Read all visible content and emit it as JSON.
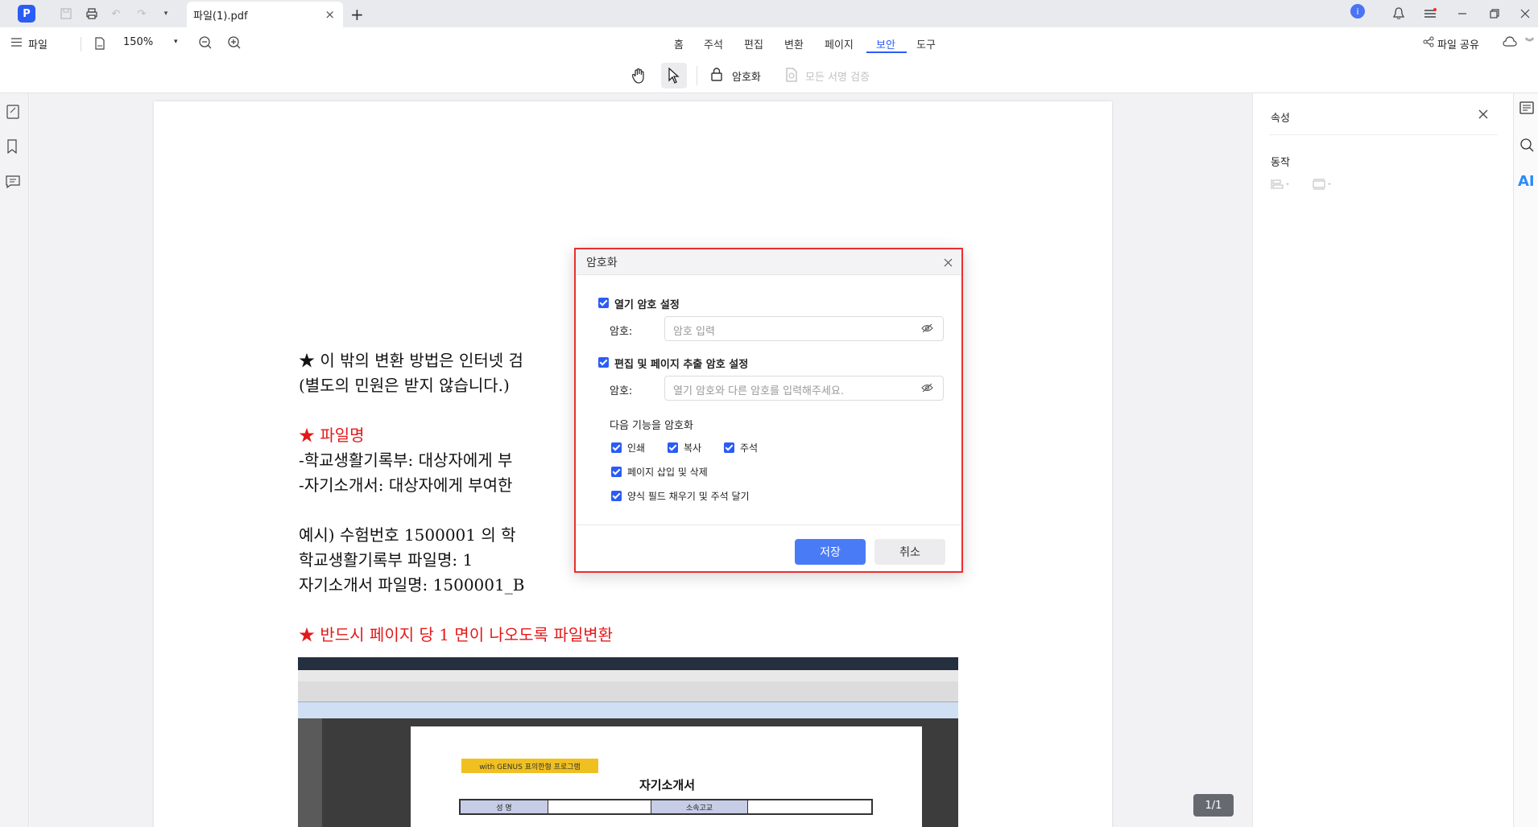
{
  "titlebar": {
    "tab_title": "파일(1).pdf",
    "tab_close": "×",
    "new_tab": "+"
  },
  "toolbar": {
    "file_menu": "파일",
    "zoom": "150%",
    "menus": [
      "홈",
      "주석",
      "편집",
      "변환",
      "페이지",
      "보안",
      "도구"
    ],
    "active_menu": "보안",
    "encrypt_label": "암호화",
    "verify_signatures_label": "모든 서명 검증",
    "share_label": "파일 공유"
  },
  "right_panel": {
    "title": "속성",
    "section": "동작",
    "ai_label": "AI"
  },
  "document": {
    "lines": [
      {
        "text": "★  이  밖의  변환  방법은  인터넷  검",
        "red": false
      },
      {
        "text": "   (별도의  민원은  받지  않습니다.)",
        "red": false
      },
      {
        "text": "★  파일명",
        "red": true
      },
      {
        "text": "   -학교생활기록부:  대상자에게  부",
        "red": false
      },
      {
        "text": "   -자기소개서:  대상자에게  부여한",
        "red": false
      },
      {
        "text": "   예시)  수험번호  1500001 의  학",
        "red": false
      },
      {
        "text": "            학교생활기록부  파일명:  1",
        "red": false
      },
      {
        "text": "            자기소개서  파일명:  1500001_B",
        "red": false
      },
      {
        "text": "★  반드시  페이지  당  1 면이  나오도록  파일변환",
        "red": true
      }
    ],
    "embedded_heading": "자기소개서",
    "embedded_badge": "with GENUS 표의한형 프로그램",
    "embedded_cells": [
      "성    명",
      "소속고교"
    ]
  },
  "page_counter": "1/1",
  "dialog": {
    "title": "암호화",
    "open_password_label": "열기 암호 설정",
    "password_label": "암호:",
    "open_password_placeholder": "암호 입력",
    "permission_password_label": "편집 및 페이지 추출 암호 설정",
    "permission_password_placeholder": "열기 암호와 다른 암호를 입력해주세요.",
    "encrypt_features_label": "다음 기능을 암호화",
    "options": {
      "print": "인쇄",
      "copy": "복사",
      "annotate": "주석",
      "insert_delete": "페이지 삽입 및 삭제",
      "fill_forms": "양식 필드 채우기 및 주석 달기"
    },
    "save_label": "저장",
    "cancel_label": "취소"
  },
  "colors": {
    "accent": "#2b5cf5",
    "highlight_border": "#e8302f",
    "red_text": "#e31919"
  }
}
